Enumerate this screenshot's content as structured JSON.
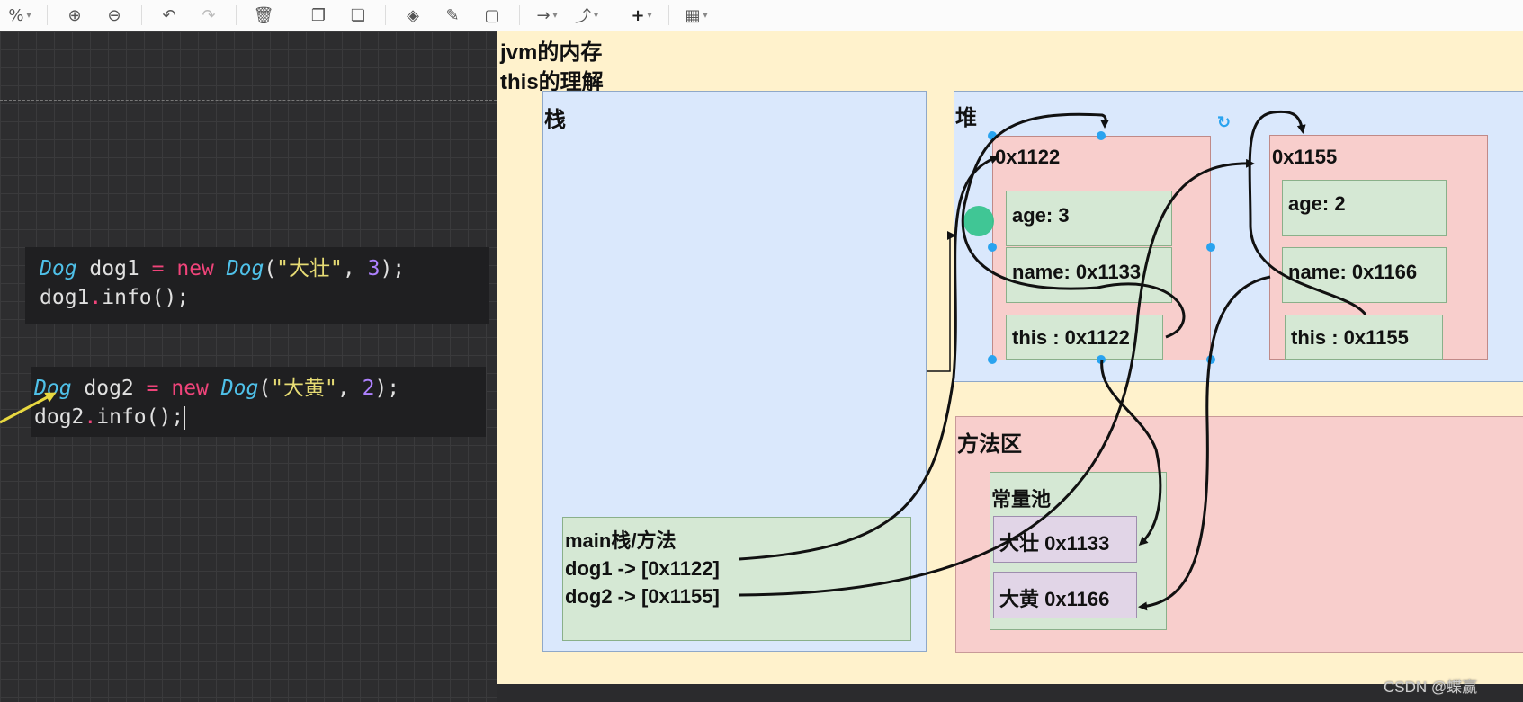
{
  "toolbar": {
    "zoom_label": "%",
    "icons": [
      "zoom-in-icon",
      "zoom-out-icon",
      "undo-icon",
      "redo-icon",
      "delete-icon",
      "to-front-icon",
      "to-back-icon",
      "fill-color-icon",
      "line-color-icon",
      "shadow-icon",
      "connection-icon",
      "waypoints-icon",
      "insert-icon",
      "table-icon"
    ]
  },
  "code": {
    "block1": {
      "line1": {
        "type": "Dog",
        "var": " dog1 ",
        "eq": "=",
        "sp": " ",
        "new": "new",
        "sp2": " ",
        "type2": "Dog",
        "open": "(",
        "str": "\"大壮\"",
        "comma": ", ",
        "num": "3",
        "close": ");"
      },
      "line2": {
        "obj": "dog1",
        "dot": ".",
        "call": "info();"
      }
    },
    "block2": {
      "line1": {
        "type": "Dog",
        "var": " dog2 ",
        "eq": "=",
        "sp": " ",
        "new": "new",
        "sp2": " ",
        "type2": "Dog",
        "open": "(",
        "str": "\"大黄\"",
        "comma": ", ",
        "num": "2",
        "close": ");"
      },
      "line2": {
        "obj": "dog2",
        "dot": ".",
        "call": "info();"
      }
    }
  },
  "diagram": {
    "title_line1": "jvm的内存",
    "title_line2": "this的理解",
    "stack": {
      "label": "栈",
      "main": {
        "title": "main栈/方法",
        "line1": "dog1 -> [0x1122]",
        "line2": "dog2 -> [0x1155]"
      }
    },
    "heap": {
      "label": "堆",
      "obj1": {
        "addr": "0x1122",
        "age": "age: 3",
        "name": "name: 0x1133",
        "this": "this : 0x1122"
      },
      "obj2": {
        "addr": "0x1155",
        "age": "age: 2",
        "name": "name: 0x1166",
        "this": "this : 0x1155"
      }
    },
    "method_area": {
      "label": "方法区",
      "pool_label": "常量池",
      "item1": "大壮 0x1133",
      "item2": "大黄 0x1166"
    }
  },
  "watermark": "CSDN @蝶赢",
  "colors": {
    "stack": "#dae8fc",
    "heap_obj": "#f8cecc",
    "field": "#d5e8d4",
    "pool_item": "#e1d5e7",
    "outer": "#fff2cc",
    "selection": "#29a3ef"
  }
}
